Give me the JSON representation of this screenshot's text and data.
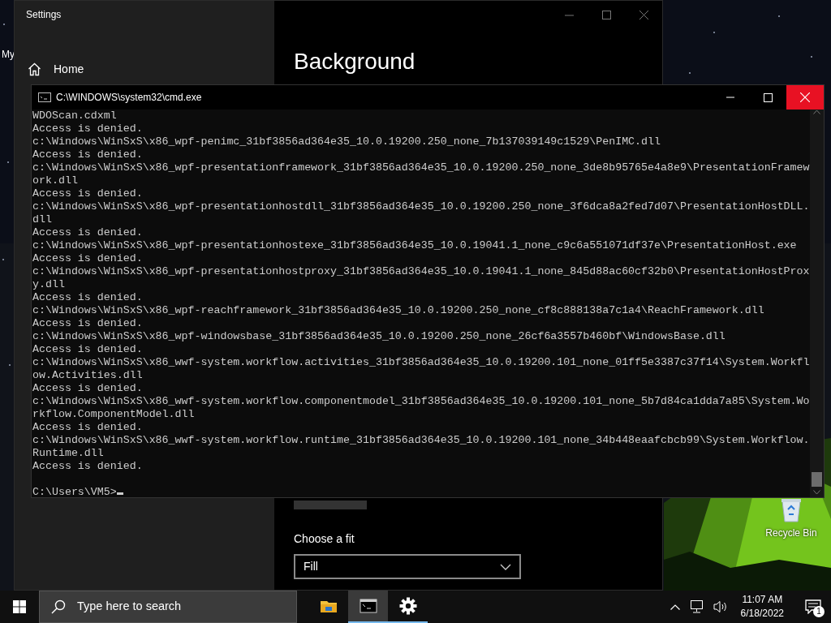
{
  "desktop": {
    "icons": [
      {
        "kind": "cut",
        "label": "My"
      },
      {
        "kind": "recycle-bin",
        "label": "Recycle Bin"
      }
    ]
  },
  "settings": {
    "title": "Settings",
    "nav": [
      {
        "label": "Home"
      }
    ],
    "heading": "Background",
    "fit_label": "Choose a fit",
    "fit": {
      "value": "Fill"
    }
  },
  "console": {
    "title": "C:\\WINDOWS\\system32\\cmd.exe",
    "lines": [
      "WDOScan.cdxml",
      "Access is denied.",
      "c:\\Windows\\WinSxS\\x86_wpf-penimc_31bf3856ad364e35_10.0.19200.250_none_7b137039149c1529\\PenIMC.dll",
      "Access is denied.",
      "c:\\Windows\\WinSxS\\x86_wpf-presentationframework_31bf3856ad364e35_10.0.19200.250_none_3de8b95765e4a8e9\\PresentationFramew",
      "ork.dll",
      "Access is denied.",
      "c:\\Windows\\WinSxS\\x86_wpf-presentationhostdll_31bf3856ad364e35_10.0.19200.250_none_3f6dca8a2fed7d07\\PresentationHostDLL.",
      "dll",
      "Access is denied.",
      "c:\\Windows\\WinSxS\\x86_wpf-presentationhostexe_31bf3856ad364e35_10.0.19041.1_none_c9c6a551071df37e\\PresentationHost.exe",
      "Access is denied.",
      "c:\\Windows\\WinSxS\\x86_wpf-presentationhostproxy_31bf3856ad364e35_10.0.19041.1_none_845d88ac60cf32b0\\PresentationHostProx",
      "y.dll",
      "Access is denied.",
      "c:\\Windows\\WinSxS\\x86_wpf-reachframework_31bf3856ad364e35_10.0.19200.250_none_cf8c888138a7c1a4\\ReachFramework.dll",
      "Access is denied.",
      "c:\\Windows\\WinSxS\\x86_wpf-windowsbase_31bf3856ad364e35_10.0.19200.250_none_26cf6a3557b460bf\\WindowsBase.dll",
      "Access is denied.",
      "c:\\Windows\\WinSxS\\x86_wwf-system.workflow.activities_31bf3856ad364e35_10.0.19200.101_none_01ff5e3387c37f14\\System.Workfl",
      "ow.Activities.dll",
      "Access is denied.",
      "c:\\Windows\\WinSxS\\x86_wwf-system.workflow.componentmodel_31bf3856ad364e35_10.0.19200.101_none_5b7d84ca1dda7a85\\System.Wo",
      "rkflow.ComponentModel.dll",
      "Access is denied.",
      "c:\\Windows\\WinSxS\\x86_wwf-system.workflow.runtime_31bf3856ad364e35_10.0.19200.101_none_34b448eaafcbcb99\\System.Workflow.",
      "Runtime.dll",
      "Access is denied."
    ],
    "prompt": "C:\\Users\\VM5>"
  },
  "taskbar": {
    "search": {
      "placeholder": "Type here to search"
    },
    "apps": [
      {
        "kind": "folder",
        "running": false,
        "selected": false
      },
      {
        "kind": "console",
        "running": true,
        "selected": true
      },
      {
        "kind": "settings",
        "running": true,
        "selected": false
      }
    ],
    "time": "11:07 AM",
    "date": "6/18/2022",
    "notifications": "1"
  }
}
